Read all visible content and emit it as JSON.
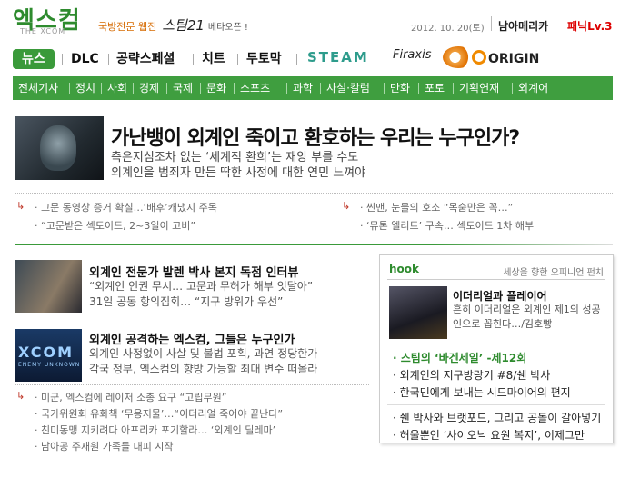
{
  "header": {
    "logo": "엑스컴",
    "logo_sub": "THE XCOM",
    "tagline": "국방전문 웹진",
    "tagline_brand": "스팀21",
    "tagline_beta": "베타오픈 !",
    "date": "2012. 10. 20(토)",
    "user": "남아메리카",
    "level": "패닉Lv.3"
  },
  "nav1": {
    "items": [
      "뉴스",
      "DLC",
      "공략스페셜",
      "치트",
      "두토막"
    ],
    "brands": [
      "STEAM",
      "Firaxis",
      "ORIGIN"
    ]
  },
  "nav2": {
    "items": [
      "전체기사",
      "정치",
      "사회",
      "경제",
      "국제",
      "문화",
      "스포츠",
      "과학",
      "사설·칼럼",
      "만화",
      "포토",
      "기획연재",
      "외계어"
    ]
  },
  "headline": {
    "title": "가난뱅이 외계인 죽이고 환호하는 우리는 누구인가?",
    "sub1": "측은지심조차 없는 ‘세계적 환희’는 재앙 부를 수도",
    "sub2": "외계인을 범죄자 만든 딱한 사정에 대한 연민 느껴야",
    "related_left": [
      "고문 동영상 증거 확실…‘배후’캐냈지 주목",
      "“고문받은 섹토이드, 2~3일이 고비”"
    ],
    "related_right": [
      "씬맨, 눈물의 호소 “목숨만은 꼭…”",
      "‘뮤톤 엘리트’ 구속… 섹토이드 1차 해부"
    ]
  },
  "stories": [
    {
      "title": "외계인 전문가 발렌 박사 본지 독점 인터뷰",
      "lines": [
        "“외계인 인권 무시… 고문과 무허가 해부 잇달아”",
        "31일 공동 항의집회… “지구 방위가 우선”"
      ]
    },
    {
      "title": "외계인 공격하는 엑스컴, 그들은 누구인가",
      "lines": [
        "외계인 사정없이 사살 및 불법 포획, 과연 정당한가",
        "각국 정부, 엑스컴의 향방 가능할 최대 변수 떠올라"
      ],
      "image_text": [
        "XCOM",
        "ENEMY UNKNOWN"
      ]
    }
  ],
  "bullets": [
    "미군, 엑스컴에 레이저 소총 요구 “고립무원”",
    "국가위원회 유화책 ‘무용지물’…“이더리얼 죽어야 끝난다”",
    "친미동맹 지키려다 아프리카 포기할라… ‘외계인 딜레마’",
    "남아공 주재원 가족들 대피 시작"
  ],
  "hook": {
    "head": "hook",
    "right": "세상을 향한 오피니언 펀치",
    "title": "이더리얼과 플레이어",
    "desc": [
      "흔히 이더리얼은 외계인 제1의 성공",
      "인으로 꼽힌다…/김호빵"
    ],
    "links": [
      "스팀의 ‘바겐세일’ -제12회",
      "외계인의 지구방랑기 #8/쉔 박사",
      "한국민에게 보내는 시드마이어의 편지",
      "쉔 박사와 브랫포드, 그리고 공돌이 갈아넣기",
      "허울뿐인 ‘사이오닉 요원 복지’, 이제그만"
    ]
  },
  "colors": {
    "brand_green": "#3a9a3a",
    "level_red": "#dd0000",
    "tagline_orange": "#d66a00"
  }
}
